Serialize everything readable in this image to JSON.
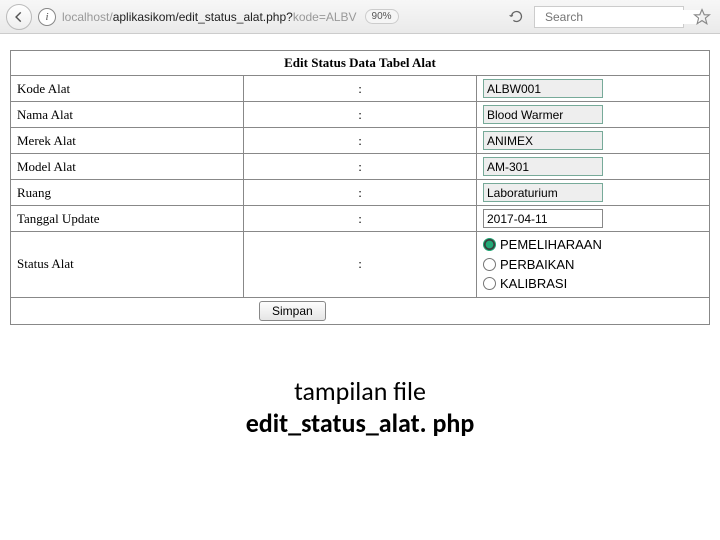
{
  "browser": {
    "url_prefix_dim": "localhost/",
    "url_mid": "aplikasikom/edit_status_alat.php?",
    "url_suffix_dim": "kode=ALBV",
    "zoom": "90%",
    "search_placeholder": "Search"
  },
  "form": {
    "header": "Edit Status Data Tabel Alat",
    "rows": {
      "kode": {
        "label": "Kode Alat",
        "value": "ALBW001"
      },
      "nama": {
        "label": "Nama Alat",
        "value": "Blood Warmer"
      },
      "merek": {
        "label": "Merek Alat",
        "value": "ANIMEX"
      },
      "model": {
        "label": "Model Alat",
        "value": "AM-301"
      },
      "ruang": {
        "label": "Ruang",
        "value": "Laboraturium"
      },
      "tanggal": {
        "label": "Tanggal Update",
        "value": "2017-04-11"
      },
      "status": {
        "label": "Status Alat",
        "options": {
          "a": "PEMELIHARAAN",
          "b": "PERBAIKAN",
          "c": "KALIBRASI"
        }
      }
    },
    "submit": "Simpan"
  },
  "caption": {
    "line1": "tampilan file",
    "line2": "edit_status_alat. php"
  }
}
